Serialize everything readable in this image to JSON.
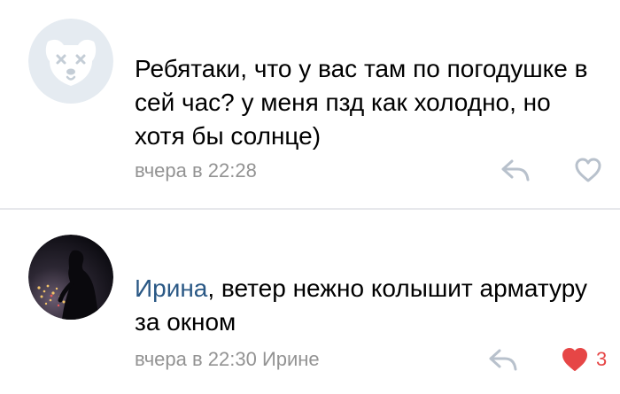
{
  "comments": [
    {
      "avatar": "deactivated-dog-avatar",
      "text": "Ребятаки, что у вас там по погодушке в сей час? у меня пзд как холодно, но хотя бы солнце)",
      "time": "вчера в 22:28",
      "like_count": "",
      "liked": false
    },
    {
      "avatar": "night-city-silhouette-avatar",
      "reply_to": "Ирина",
      "text": ", ветер нежно колышит арматуру за окном",
      "time": "вчера в 22:30 Ирине",
      "like_count": "3",
      "liked": true
    }
  ],
  "colors": {
    "link": "#2a5885",
    "meta": "#939393",
    "icon": "#b8c1cc",
    "like_active": "#e64646",
    "divider": "#e7e8ec"
  },
  "icons": {
    "reply": "reply-arrow-icon",
    "like": "heart-icon"
  }
}
